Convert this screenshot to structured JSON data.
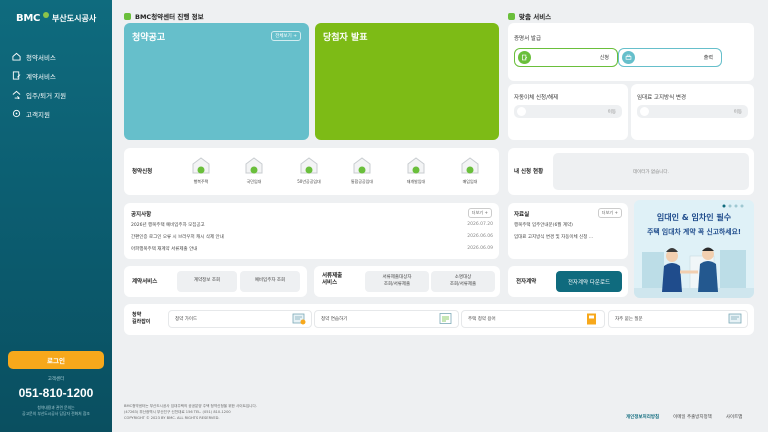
{
  "sidebar": {
    "logo_mark": "BMC",
    "logo_text": "부산도시공사",
    "nav": [
      "청약서비스",
      "계약서비스",
      "입주/퇴거 지원",
      "고객지원"
    ],
    "login": "로그인",
    "cs_label": "고객센터",
    "cs_phone": "051-810-1200",
    "cs_note_1": "청약내용과 관련 문의는",
    "cs_note_2": "공고문의 부산도시공사 담당자 전화처 참조"
  },
  "section": {
    "left_title": "BMC청약센터 진행 정보",
    "right_title": "맞춤 서비스"
  },
  "tiles": {
    "announcement": "청약공고",
    "announcement_more": "전체보기 +",
    "winners": "당첨자 발표"
  },
  "cert": {
    "title": "증명서 발급",
    "apply": "신청",
    "print": "출력"
  },
  "auto_transfer": {
    "title": "자동이체 신청/해제",
    "move": "이동"
  },
  "lease_notice": {
    "title": "임대료 고지방식 변경",
    "move": "이동"
  },
  "apply": {
    "title": "청약신청",
    "items": [
      "행복주택",
      "국민임대",
      "50년공공임대",
      "통합공공임대",
      "재개발임대",
      "매입임대"
    ]
  },
  "my_status": {
    "title": "내 신청 현황",
    "empty": "데이터가 없습니다."
  },
  "notice": {
    "title": "공지사항",
    "more": "더보기 +",
    "rows": [
      {
        "text": "2026년 행복주택 예비입주자 모집공고",
        "date": "2026.07.20"
      },
      {
        "text": "간편인증 로그인 오류 시 브라우저 캐시 삭제 안내",
        "date": "2026.06.06"
      },
      {
        "text": "아파행복주택 재계약 서류제출 안내",
        "date": "2026.06.09"
      }
    ]
  },
  "archive": {
    "title": "자료실",
    "more": "더보기 +",
    "rows": [
      "행복주택 입주안내문(6월 계약)",
      "임대료 고지방식 변경 및 자동이체 신청 ..."
    ]
  },
  "banner": {
    "line1": "임대인 & 임차인 필수",
    "line2": "주택 임대차 계약 꼭 신고하세요!"
  },
  "contract": {
    "title": "계약서비스",
    "btn1": "계약정보 조회",
    "btn2": "예비입주자 조회"
  },
  "docs": {
    "title_1": "서류제출",
    "title_2": "서비스",
    "btn1_1": "서류제출대상자",
    "btn1_2": "조회/서류제출",
    "btn2_1": "소명대상",
    "btn2_2": "조회/서류제출"
  },
  "e_contract": {
    "title": "전자계약",
    "download": "전자계약 다운로드"
  },
  "guide": {
    "title_1": "청약",
    "title_2": "길라잡이",
    "items": [
      "청약 가이드",
      "청약 연습하기",
      "주택 청약 용어",
      "자주 묻는 질문"
    ]
  },
  "footer": {
    "line1": "BMC청약센터는 부산도시공사 임대주택의 공공분양 주택 청약신청을 위한 사이트입니다.",
    "line2": "(47263) 부산광역시 부산진구 신천대로 156 TEL. (051) 810-1200",
    "line3": "COPYRIGHT © 2023 BY BMC. ALL RIGHTS RESERVED.",
    "privacy": "개인정보처리방침",
    "email": "이메일 추출방지정책",
    "sitemap": "사이트맵"
  },
  "colors": {
    "sidebar": "#0f6b7e",
    "teal": "#66bfcb",
    "green": "#7dbb16",
    "orange": "#f7a81b"
  }
}
